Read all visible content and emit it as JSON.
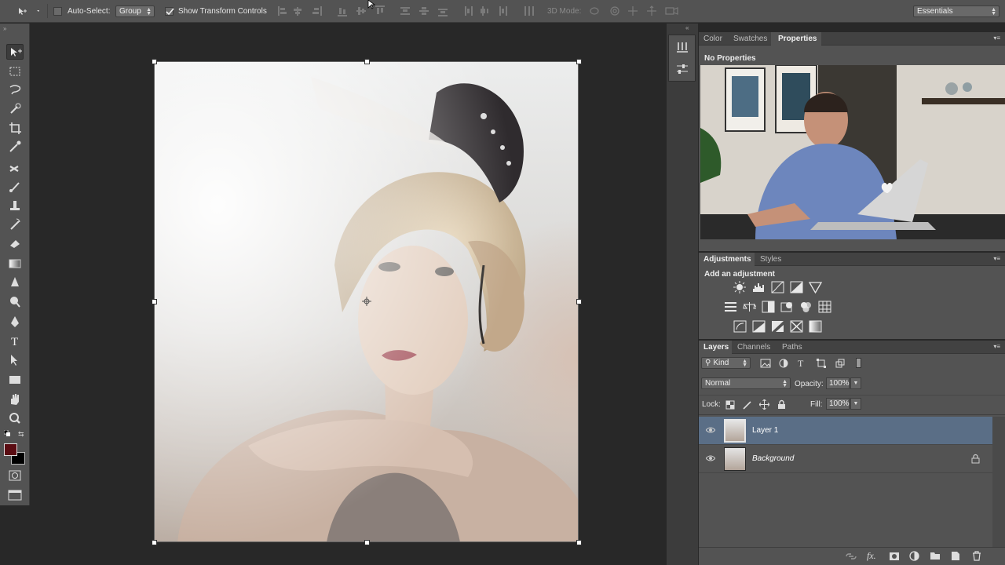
{
  "options_bar": {
    "auto_select_label": "Auto-Select:",
    "auto_select_value": "Group",
    "show_transform_label": "Show Transform Controls",
    "mode_3d_label": "3D Mode:",
    "workspace_value": "Essentials"
  },
  "properties_panel": {
    "tabs": [
      "Color",
      "Swatches",
      "Properties"
    ],
    "active_tab": "Properties",
    "title": "No Properties"
  },
  "adjustments_panel": {
    "tabs": [
      "Adjustments",
      "Styles"
    ],
    "active_tab": "Adjustments",
    "title": "Add an adjustment",
    "icons": [
      [
        "brightness-contrast-icon",
        "levels-icon",
        "curves-icon",
        "exposure-icon",
        "vibrance-icon"
      ],
      [
        "hue-saturation-icon",
        "color-balance-icon",
        "black-white-icon",
        "photo-filter-icon",
        "channel-mixer-icon",
        "color-lookup-icon"
      ],
      [
        "invert-icon",
        "posterize-icon",
        "threshold-icon",
        "selective-color-icon",
        "gradient-map-icon"
      ]
    ]
  },
  "layers_panel": {
    "tabs": [
      "Layers",
      "Channels",
      "Paths"
    ],
    "active_tab": "Layers",
    "filter_kind": "Kind",
    "blend_mode": "Normal",
    "opacity_label": "Opacity:",
    "opacity_value": "100%",
    "lock_label": "Lock:",
    "fill_label": "Fill:",
    "fill_value": "100%",
    "layers": [
      {
        "name": "Layer 1",
        "selected": true,
        "locked": false
      },
      {
        "name": "Background",
        "selected": false,
        "locked": true
      }
    ]
  },
  "colors": {
    "foreground": "#5a0c12",
    "background": "#000000",
    "selection": "#5a6e86",
    "panel": "#535353"
  }
}
